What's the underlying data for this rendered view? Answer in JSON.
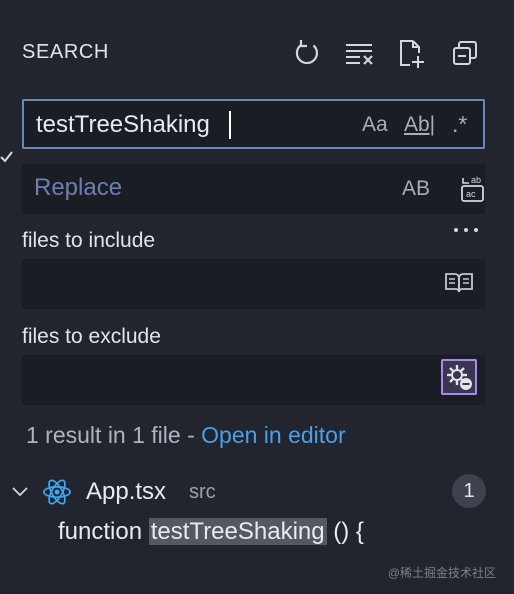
{
  "header": {
    "title": "SEARCH",
    "icons": [
      "refresh-icon",
      "clear-results-icon",
      "new-search-editor-icon",
      "collapse-all-icon"
    ]
  },
  "search": {
    "value": "testTreeShaking",
    "match_case": "Aa",
    "whole_word": "Ab|",
    "regex": ".*"
  },
  "replace": {
    "placeholder": "Replace",
    "preserve_case": "AB"
  },
  "include": {
    "label": "files to include",
    "value": ""
  },
  "exclude": {
    "label": "files to exclude",
    "value": ""
  },
  "status": {
    "summary": "1 result in 1 file - ",
    "open_editor": "Open in editor"
  },
  "results": {
    "file": {
      "name": "App.tsx",
      "folder": "src",
      "count": "1"
    },
    "match": {
      "before": "function ",
      "term": "testTreeShaking",
      "after": " () {"
    }
  },
  "watermark": "@稀土掘金技术社区",
  "colors": {
    "background": "#22252e",
    "input_background": "#1a1d24",
    "focus_border": "#6e87bb",
    "link": "#4a9fe8",
    "react_icon": "#3fa9f5",
    "active_toggle_border": "#a68ce8"
  }
}
